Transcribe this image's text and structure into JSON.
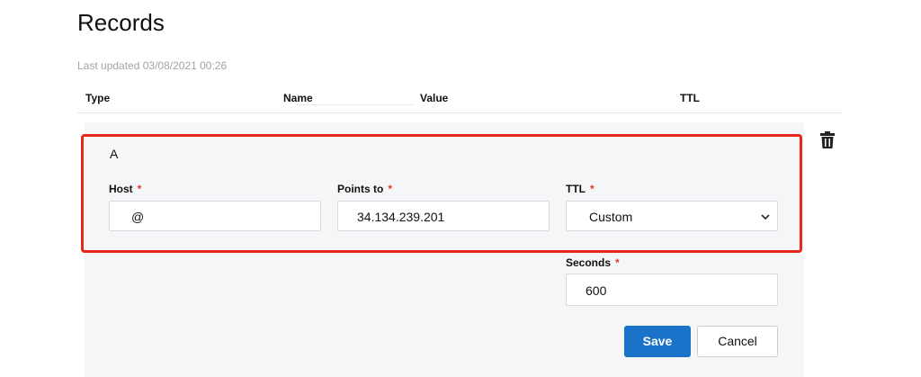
{
  "page": {
    "title": "Records",
    "last_updated": "Last updated 03/08/2021 00:26"
  },
  "table": {
    "columns": [
      "Type",
      "Name",
      "Value",
      "TTL"
    ]
  },
  "record": {
    "type": "A",
    "host": {
      "label": "Host",
      "required": "*",
      "value": "@"
    },
    "points_to": {
      "label": "Points to",
      "required": "*",
      "value": "34.134.239.201"
    },
    "ttl": {
      "label": "TTL",
      "required": "*",
      "value": "Custom"
    },
    "seconds": {
      "label": "Seconds",
      "required": "*",
      "value": "600"
    }
  },
  "actions": {
    "save": "Save",
    "cancel": "Cancel"
  },
  "colors": {
    "highlight": "#e8271a",
    "primary": "#1a73c8",
    "required": "#e0362c"
  },
  "icons": {
    "delete": "trash-icon",
    "dropdown": "chevron-down-icon"
  }
}
